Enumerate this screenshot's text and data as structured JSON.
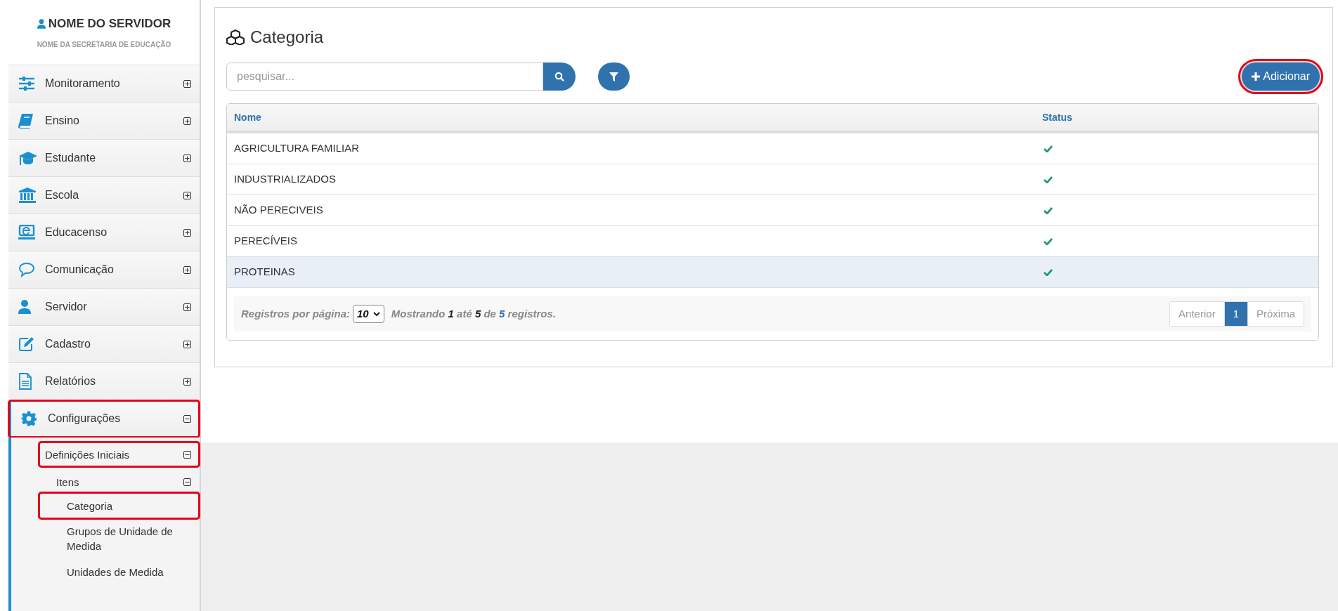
{
  "sidebar": {
    "user_name": "NOME DO SERVIDOR",
    "organization": "NOME DA SECRETARIA DE EDUCAÇÃO",
    "menu": [
      {
        "label": "Monitoramento",
        "expanded": false,
        "highlighted": false
      },
      {
        "label": "Ensino",
        "expanded": false,
        "highlighted": false
      },
      {
        "label": "Estudante",
        "expanded": false,
        "highlighted": false
      },
      {
        "label": "Escola",
        "expanded": false,
        "highlighted": false
      },
      {
        "label": "Educacenso",
        "expanded": false,
        "highlighted": false
      },
      {
        "label": "Comunicação",
        "expanded": false,
        "highlighted": false
      },
      {
        "label": "Servidor",
        "expanded": false,
        "highlighted": false
      },
      {
        "label": "Cadastro",
        "expanded": false,
        "highlighted": false
      },
      {
        "label": "Relatórios",
        "expanded": false,
        "highlighted": false
      },
      {
        "label": "Configurações",
        "expanded": true,
        "highlighted": true,
        "children": [
          {
            "label": "Definições Iniciais",
            "expanded": true,
            "highlighted": true,
            "children": [
              {
                "label": "Itens",
                "expanded": true,
                "highlighted": false,
                "children": [
                  {
                    "label": "Categoria",
                    "highlighted": true
                  },
                  {
                    "label": "Grupos de Unidade de Medida",
                    "highlighted": false
                  },
                  {
                    "label": "Unidades de Medida",
                    "highlighted": false
                  }
                ]
              }
            ]
          }
        ]
      }
    ]
  },
  "page": {
    "title": "Categoria",
    "search": {
      "placeholder": "pesquisar..."
    },
    "add_button": {
      "label": "Adicionar",
      "highlighted": true
    },
    "table": {
      "columns": [
        "Nome",
        "Status"
      ],
      "rows": [
        {
          "nome": "AGRICULTURA FAMILIAR",
          "active": true,
          "selected": false
        },
        {
          "nome": "INDUSTRIALIZADOS",
          "active": true,
          "selected": false
        },
        {
          "nome": "NÃO PERECIVEIS",
          "active": true,
          "selected": false
        },
        {
          "nome": "PERECÍVEIS",
          "active": true,
          "selected": false
        },
        {
          "nome": "PROTEINAS",
          "active": true,
          "selected": true
        }
      ]
    },
    "footer": {
      "per_page_label": "Registros por página:",
      "per_page_value": "10",
      "summary": [
        {
          "kind": "text",
          "text": "Mostrando "
        },
        {
          "kind": "number",
          "text": "1"
        },
        {
          "kind": "text",
          "text": " até "
        },
        {
          "kind": "number",
          "text": "5"
        },
        {
          "kind": "text",
          "text": " de "
        },
        {
          "kind": "total",
          "text": "5"
        },
        {
          "kind": "text",
          "text": " registros."
        }
      ],
      "pagination": [
        {
          "label": "Anterior",
          "selected": false
        },
        {
          "label": "1",
          "selected": true
        },
        {
          "label": "Próxima",
          "selected": false
        }
      ]
    }
  }
}
